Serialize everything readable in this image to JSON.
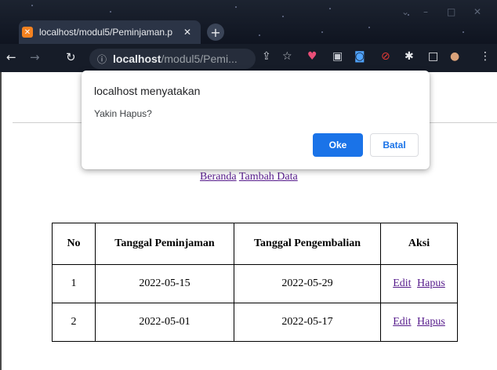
{
  "browser": {
    "tab_title": "localhost/modul5/Peminjaman.p",
    "tab_favicon": "xampp-icon",
    "url_host": "localhost",
    "url_path": "/modul5/Pemi..."
  },
  "dialog": {
    "title": "localhost menyatakan",
    "message": "Yakin Hapus?",
    "ok_label": "Oke",
    "cancel_label": "Batal",
    "ok_color": "#1a73e8"
  },
  "nav": {
    "home_label": "Beranda",
    "add_label": "Tambah Data"
  },
  "table": {
    "headers": [
      "No",
      "Tanggal Peminjaman",
      "Tanggal Pengembalian",
      "Aksi"
    ],
    "rows": [
      {
        "no": "1",
        "tanggal_peminjaman": "2022-05-15",
        "tanggal_pengembalian": "2022-05-29",
        "edit_label": "Edit",
        "hapus_label": "Hapus"
      },
      {
        "no": "2",
        "tanggal_peminjaman": "2022-05-01",
        "tanggal_pengembalian": "2022-05-17",
        "edit_label": "Edit",
        "hapus_label": "Hapus"
      }
    ]
  },
  "colors": {
    "link_visited": "#551a8b",
    "chrome_dark": "#161c28"
  }
}
